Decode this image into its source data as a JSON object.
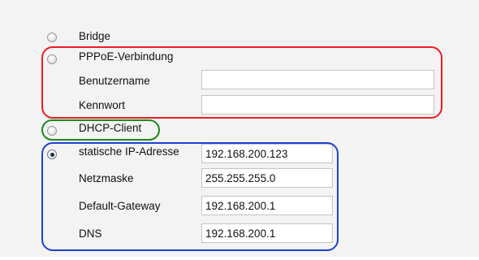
{
  "options": {
    "bridge": {
      "label": "Bridge",
      "checked": false
    },
    "pppoe": {
      "label": "PPPoE-Verbindung",
      "checked": false,
      "username_label": "Benutzername",
      "username_value": "",
      "password_label": "Kennwort",
      "password_value": ""
    },
    "dhcp": {
      "label": "DHCP-Client",
      "checked": false
    },
    "static": {
      "label": "statische IP-Adresse",
      "checked": true,
      "ip_value": "192.168.200.123",
      "netmask_label": "Netzmaske",
      "netmask_value": "255.255.255.0",
      "gateway_label": "Default-Gateway",
      "gateway_value": "192.168.200.1",
      "dns_label": "DNS",
      "dns_value": "192.168.200.1"
    }
  },
  "annotation_colors": {
    "pppoe_frame": "#ee1c24",
    "dhcp_frame": "#1d8a1d",
    "static_frame": "#1f3fd6"
  }
}
